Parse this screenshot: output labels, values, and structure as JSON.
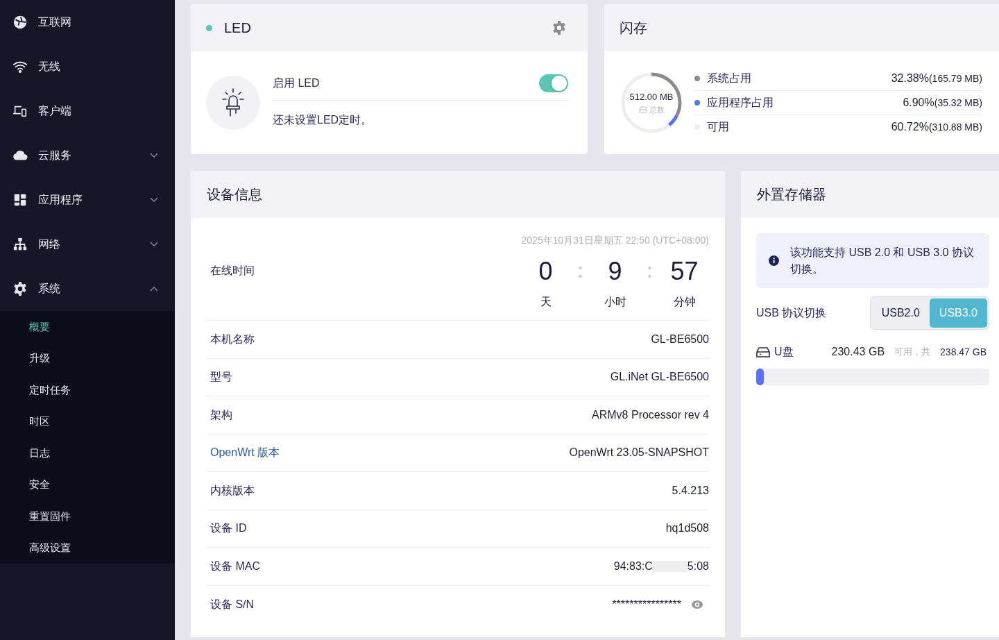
{
  "sidebar": {
    "items": [
      {
        "kind": "link",
        "label": "互联网"
      },
      {
        "kind": "link",
        "label": "无线"
      },
      {
        "kind": "link",
        "label": "客户端"
      },
      {
        "kind": "group",
        "label": "云服务",
        "expanded": false
      },
      {
        "kind": "group",
        "label": "应用程序",
        "expanded": false
      },
      {
        "kind": "group",
        "label": "网络",
        "expanded": false
      },
      {
        "kind": "group",
        "label": "系统",
        "expanded": true,
        "children": [
          {
            "label": "概要",
            "selected": true
          },
          {
            "label": "升级",
            "selected": false
          },
          {
            "label": "定时任务",
            "selected": false
          },
          {
            "label": "时区",
            "selected": false
          },
          {
            "label": "日志",
            "selected": false
          },
          {
            "label": "安全",
            "selected": false
          },
          {
            "label": "重置固件",
            "selected": false
          },
          {
            "label": "高级设置",
            "selected": false
          }
        ]
      }
    ]
  },
  "led_card": {
    "title": "LED",
    "toggle_label": "启用 LED",
    "on": true,
    "note": "还未设置LED定时。"
  },
  "flash_card": {
    "title": "闪存",
    "total": "512.00 MB",
    "total_label": "总数",
    "items": [
      {
        "label": "系统占用",
        "color": "#8c8c8c",
        "percent": "32.38%",
        "size": "(165.79 MB)"
      },
      {
        "label": "应用程序占用",
        "color": "#5a73ec",
        "percent": "6.90%",
        "size": "(35.32 MB)"
      },
      {
        "label": "可用",
        "color": "#ededf3",
        "percent": "60.72%",
        "size": "(310.88 MB)"
      }
    ]
  },
  "device_card": {
    "title": "设备信息",
    "datetime": "2025年10月31日星期五 22:50 (UTC+08:00)",
    "uptime_label": "在线时间",
    "uptime": [
      {
        "value": "0",
        "unit": "天"
      },
      {
        "value": "9",
        "unit": "小时"
      },
      {
        "value": "57",
        "unit": "分钟"
      }
    ],
    "rows": [
      {
        "kind": "plain",
        "label": "本机名称",
        "value": "GL-BE6500"
      },
      {
        "kind": "plain",
        "label": "型号",
        "value": "GL.iNet GL-BE6500"
      },
      {
        "kind": "plain",
        "label": "架构",
        "value": "ARMv8 Processor rev 4"
      },
      {
        "kind": "link",
        "label": "OpenWrt 版本",
        "value": "OpenWrt 23.05-SNAPSHOT"
      },
      {
        "kind": "plain",
        "label": "内核版本",
        "value": "5.4.213"
      },
      {
        "kind": "plain",
        "label": "设备 ID",
        "value": "hq1d508"
      },
      {
        "kind": "redacted",
        "label": "设备 MAC",
        "value": "94:83:C",
        "value_end": "5:08"
      },
      {
        "kind": "secret",
        "label": "设备 S/N",
        "value": "****************"
      }
    ]
  },
  "storage_card": {
    "title": "外置存储器",
    "notice": "该功能支持 USB 2.0 和 USB 3.0 协议切换。",
    "switch_label": "USB 协议切换",
    "options": [
      {
        "label": "USB2.0",
        "selected": false
      },
      {
        "label": "USB3.0",
        "selected": true
      }
    ],
    "disk": {
      "name": "U盘",
      "free": "230.43 GB",
      "mid": "可用，共",
      "total": "238.47 GB",
      "level": 0.034
    }
  }
}
